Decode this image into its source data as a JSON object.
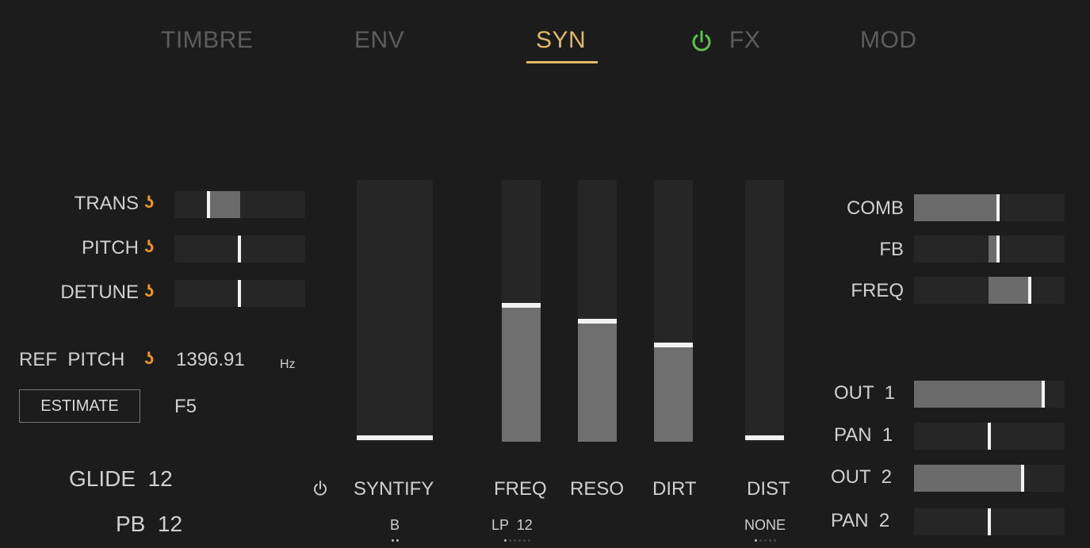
{
  "tabs": [
    {
      "label": "TIMBRE",
      "active": false
    },
    {
      "label": "ENV",
      "active": false
    },
    {
      "label": "SYN",
      "active": true
    },
    {
      "label": "FX",
      "active": false,
      "power_on": true
    },
    {
      "label": "MOD",
      "active": false
    }
  ],
  "colors": {
    "accent": "#e0b866",
    "link": "#e8962a",
    "power_on": "#5ec24a",
    "background": "#1c1c1c"
  },
  "left": {
    "trans": {
      "label": "TRANS",
      "linked": true,
      "value_fraction": 0.25
    },
    "pitch": {
      "label": "PITCH",
      "linked": true,
      "value_fraction": 0.5
    },
    "detune": {
      "label": "DETUNE",
      "linked": true,
      "value_fraction": 0.5
    },
    "ref_pitch": {
      "label": "REF  PITCH",
      "value": "1396.91",
      "unit": "Hz"
    },
    "estimate_button": "ESTIMATE",
    "note": "F5",
    "glide": "GLIDE  12",
    "pb": "PB  12"
  },
  "center": {
    "syntify": {
      "label": "SYNTIFY",
      "sub": "B",
      "value_fraction": 0.0,
      "power_icon": "power-icon"
    },
    "freq": {
      "label": "FREQ",
      "sub": "LP  12",
      "value_fraction": 0.52
    },
    "reso": {
      "label": "RESO",
      "value_fraction": 0.46
    },
    "dirt": {
      "label": "DIRT",
      "value_fraction": 0.37
    },
    "dist": {
      "label": "DIST",
      "sub": "NONE",
      "value_fraction": 0.0
    }
  },
  "right": {
    "comb": {
      "label": "COMB",
      "value_fraction": 0.56
    },
    "fb": {
      "label": "FB",
      "value_fraction": 0.56
    },
    "freq": {
      "label": "FREQ",
      "value_fraction": 0.78
    },
    "out1": {
      "label": "OUT  1",
      "value_fraction": 0.86
    },
    "pan1": {
      "label": "PAN  1",
      "value_fraction": 0.5
    },
    "out2": {
      "label": "OUT  2",
      "value_fraction": 0.72
    },
    "pan2": {
      "label": "PAN  2",
      "value_fraction": 0.5
    }
  }
}
